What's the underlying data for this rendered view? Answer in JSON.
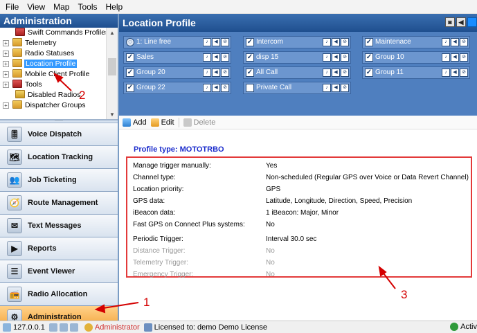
{
  "menu": [
    "File",
    "View",
    "Map",
    "Tools",
    "Help"
  ],
  "left_panel": {
    "title": "Administration",
    "tree": [
      {
        "label": "Swift Commands Profiles",
        "expander": "",
        "selected": false
      },
      {
        "label": "Telemetry",
        "expander": "+",
        "selected": false
      },
      {
        "label": "Radio Statuses",
        "expander": "+",
        "selected": false
      },
      {
        "label": "Location Profile",
        "expander": "+",
        "selected": true
      },
      {
        "label": "Mobile Client Profile",
        "expander": "+",
        "selected": false
      },
      {
        "label": "Tools",
        "expander": "+",
        "selected": false
      },
      {
        "label": "Disabled Radios",
        "expander": "",
        "selected": false
      },
      {
        "label": "Dispatcher Groups",
        "expander": "+",
        "selected": false
      }
    ],
    "nav": [
      {
        "label": "Voice Dispatch",
        "icon": "voice-dispatch-icon"
      },
      {
        "label": "Location Tracking",
        "icon": "location-tracking-icon"
      },
      {
        "label": "Job Ticketing",
        "icon": "job-ticketing-icon"
      },
      {
        "label": "Route Management",
        "icon": "route-management-icon"
      },
      {
        "label": "Text Messages",
        "icon": "envelope-icon"
      },
      {
        "label": "Reports",
        "icon": "reports-icon"
      },
      {
        "label": "Event Viewer",
        "icon": "event-viewer-icon"
      },
      {
        "label": "Radio Allocation",
        "icon": "radio-allocation-icon"
      },
      {
        "label": "Administration",
        "icon": "administration-icon",
        "active": true
      }
    ]
  },
  "main": {
    "title": "Location Profile",
    "channels": [
      {
        "label": "1: Line free",
        "checked": true,
        "kind": "line"
      },
      {
        "label": "Intercom",
        "checked": true
      },
      {
        "label": "Maintenace",
        "checked": true
      },
      {
        "label": "Sales",
        "checked": true
      },
      {
        "label": "disp 15",
        "checked": true
      },
      {
        "label": "Group 10",
        "checked": true
      },
      {
        "label": "Group 20",
        "checked": true
      },
      {
        "label": "All Call",
        "checked": true
      },
      {
        "label": "Group 11",
        "checked": true
      },
      {
        "label": "Group 22",
        "checked": true
      },
      {
        "label": "Private Call",
        "checked": false
      }
    ],
    "toolbar": {
      "add": "Add",
      "edit": "Edit",
      "delete": "Delete"
    },
    "profile_type": "Profile type: MOTOTRBO",
    "properties": [
      {
        "key": "Manage trigger manually:",
        "value": "Yes"
      },
      {
        "key": "Channel type:",
        "value": "Non-scheduled (Regular GPS over Voice or Data Revert Channel)"
      },
      {
        "key": "Location priority:",
        "value": "GPS"
      },
      {
        "key": "GPS data:",
        "value": "Latitude, Longitude, Direction, Speed, Precision"
      },
      {
        "key": "iBeacon data:",
        "value": "1 iBeacon: Major, Minor"
      },
      {
        "key": "Fast GPS on Connect Plus systems:",
        "value": "No"
      },
      {
        "key": "Periodic Trigger:",
        "value": "Interval 30.0 sec",
        "gap": true
      },
      {
        "key": "Distance Trigger:",
        "value": "No",
        "muted": true
      },
      {
        "key": "Telemetry Trigger:",
        "value": "No",
        "muted": true
      },
      {
        "key": "Emergency Trigger:",
        "value": "No",
        "muted": true
      }
    ]
  },
  "status": {
    "ip": "127.0.0.1",
    "user": "Administrator",
    "license": "Licensed to: demo Demo License",
    "active": "Activ"
  },
  "annotations": {
    "n1": "1",
    "n2": "2",
    "n3": "3"
  }
}
